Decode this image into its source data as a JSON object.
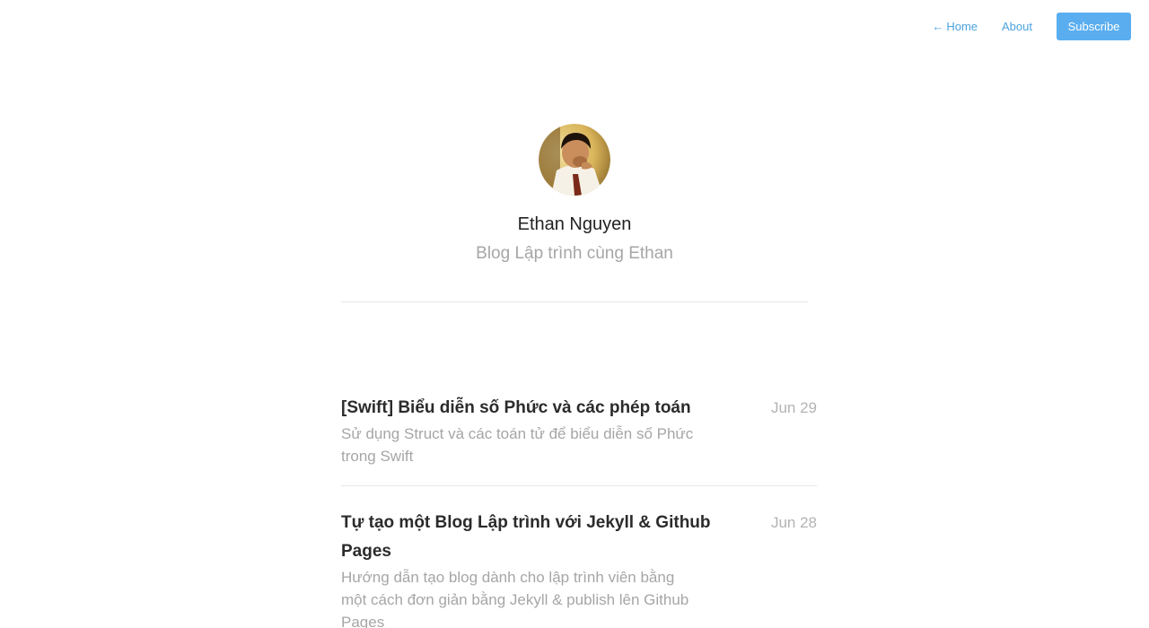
{
  "nav": {
    "home_arrow": "←",
    "home_label": "Home",
    "about_label": "About",
    "subscribe_label": "Subscribe",
    "link_color": "#4aa3df",
    "button_color": "#5aaef0"
  },
  "profile": {
    "name": "Ethan Nguyen",
    "tagline": "Blog Lập trình cùng Ethan"
  },
  "posts": [
    {
      "title": "[Swift] Biểu diễn số Phức và các phép toán",
      "date": "Jun 29",
      "excerpt": "Sử dụng Struct và các toán tử để biểu diễn số Phức trong Swift"
    },
    {
      "title": "Tự tạo một Blog Lập trình với Jekyll & Github Pages",
      "date": "Jun 28",
      "excerpt": "Hướng dẫn tạo blog dành cho lập trình viên bằng một cách đơn giản bằng Jekyll & publish lên Github Pages"
    }
  ]
}
